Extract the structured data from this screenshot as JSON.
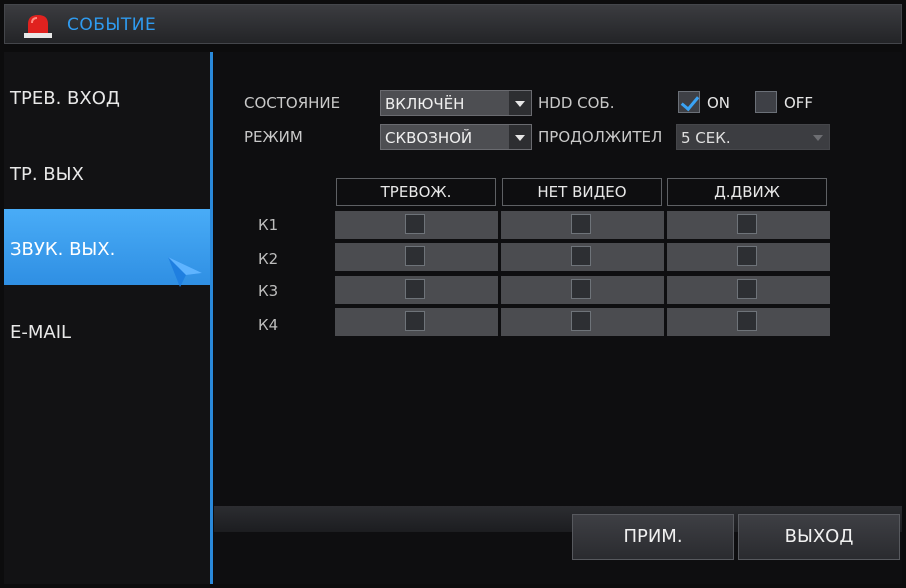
{
  "window": {
    "title": "СОБЫТИЕ",
    "title_icon": "alarm-siren-icon"
  },
  "sidebar": {
    "items": [
      {
        "label": "ТРЕВ. ВХОД",
        "active": false
      },
      {
        "label": "ТР. ВЫХ",
        "active": false
      },
      {
        "label": "ЗВУК. ВЫХ.",
        "active": true
      },
      {
        "label": "E-MAIL",
        "active": false
      }
    ],
    "active_color": "#3a9cf0"
  },
  "form": {
    "state_label": "СОСТОЯНИЕ",
    "state_value": "ВКЛЮЧЁН",
    "mode_label": "РЕЖИМ",
    "mode_value": "СКВОЗНОЙ",
    "hdd_label": "HDD СОБ.",
    "hdd_on_label": "ON",
    "hdd_on_checked": true,
    "hdd_off_label": "OFF",
    "hdd_off_checked": false,
    "duration_label": "ПРОДОЛЖИТЕЛ",
    "duration_value": "5 СЕК."
  },
  "grid": {
    "columns": [
      "ТРЕВОЖ.",
      "НЕТ ВИДЕО",
      "Д.ДВИЖ"
    ],
    "rows": [
      {
        "label": "К1",
        "values": [
          false,
          false,
          false
        ]
      },
      {
        "label": "К2",
        "values": [
          false,
          false,
          false
        ]
      },
      {
        "label": "К3",
        "values": [
          false,
          false,
          false
        ]
      },
      {
        "label": "К4",
        "values": [
          false,
          false,
          false
        ]
      }
    ]
  },
  "footer": {
    "apply_label": "ПРИМ.",
    "exit_label": "ВЫХОД"
  },
  "colors": {
    "accent": "#2f9bf0",
    "panel_divider": "#2a89da"
  }
}
